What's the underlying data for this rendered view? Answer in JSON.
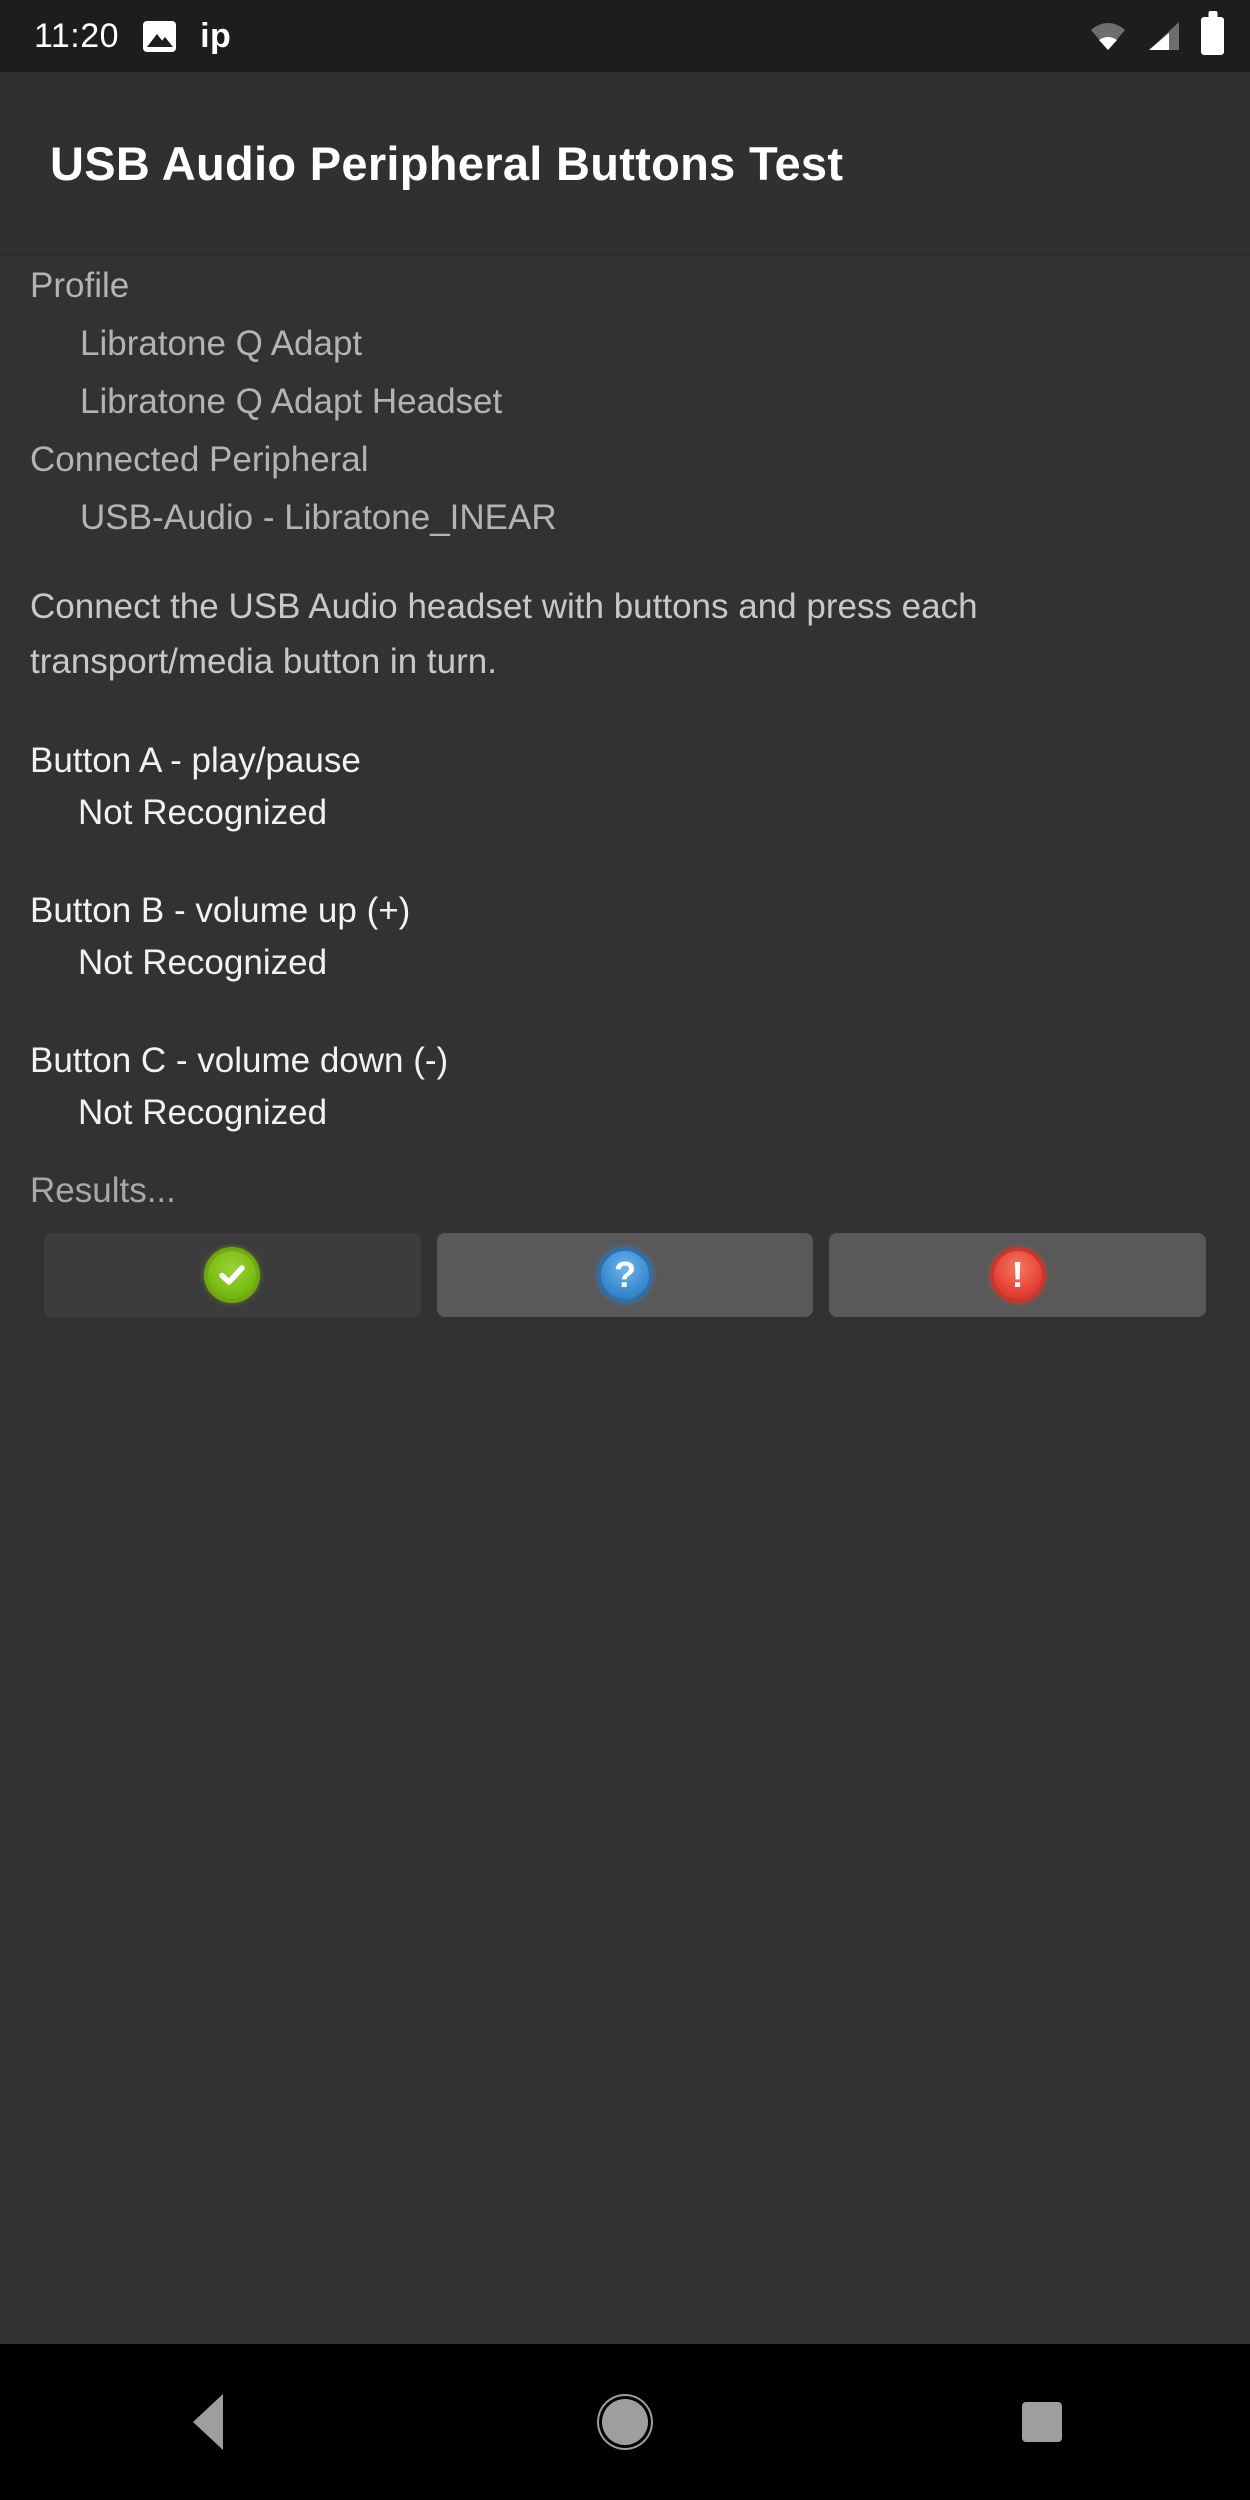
{
  "status_bar": {
    "time": "11:20",
    "notification_text": "ip",
    "icons": {
      "photo": "photo-icon",
      "wifi": "wifi-icon",
      "signal": "signal-icon",
      "battery": "battery-icon"
    }
  },
  "app_bar": {
    "title": "USB Audio Peripheral Buttons Test"
  },
  "profile_section": {
    "profile_label": "Profile",
    "profile_values": [
      "Libratone Q Adapt",
      "Libratone Q Adapt Headset"
    ],
    "connected_label": "Connected Peripheral",
    "connected_values": [
      "USB-Audio - Libratone_INEAR"
    ]
  },
  "instructions": "Connect the USB Audio headset with buttons and press each transport/media button in turn.",
  "button_tests": [
    {
      "heading": "Button A - play/pause",
      "status": "Not Recognized"
    },
    {
      "heading": "Button B - volume up (+)",
      "status": "Not Recognized"
    },
    {
      "heading": "Button C - volume down (-)",
      "status": "Not Recognized"
    }
  ],
  "results": {
    "label": "Results...",
    "buttons": [
      {
        "name": "pass",
        "icon": "check-circle-icon",
        "state": "disabled",
        "color": "#7cc014"
      },
      {
        "name": "info",
        "icon": "question-circle-icon",
        "state": "enabled",
        "color": "#3e8fd4"
      },
      {
        "name": "fail",
        "icon": "exclamation-circle-icon",
        "state": "enabled",
        "color": "#e8483a"
      }
    ]
  },
  "nav_bar": {
    "back": "back-nav-button",
    "home": "home-nav-button",
    "recents": "recents-nav-button"
  }
}
